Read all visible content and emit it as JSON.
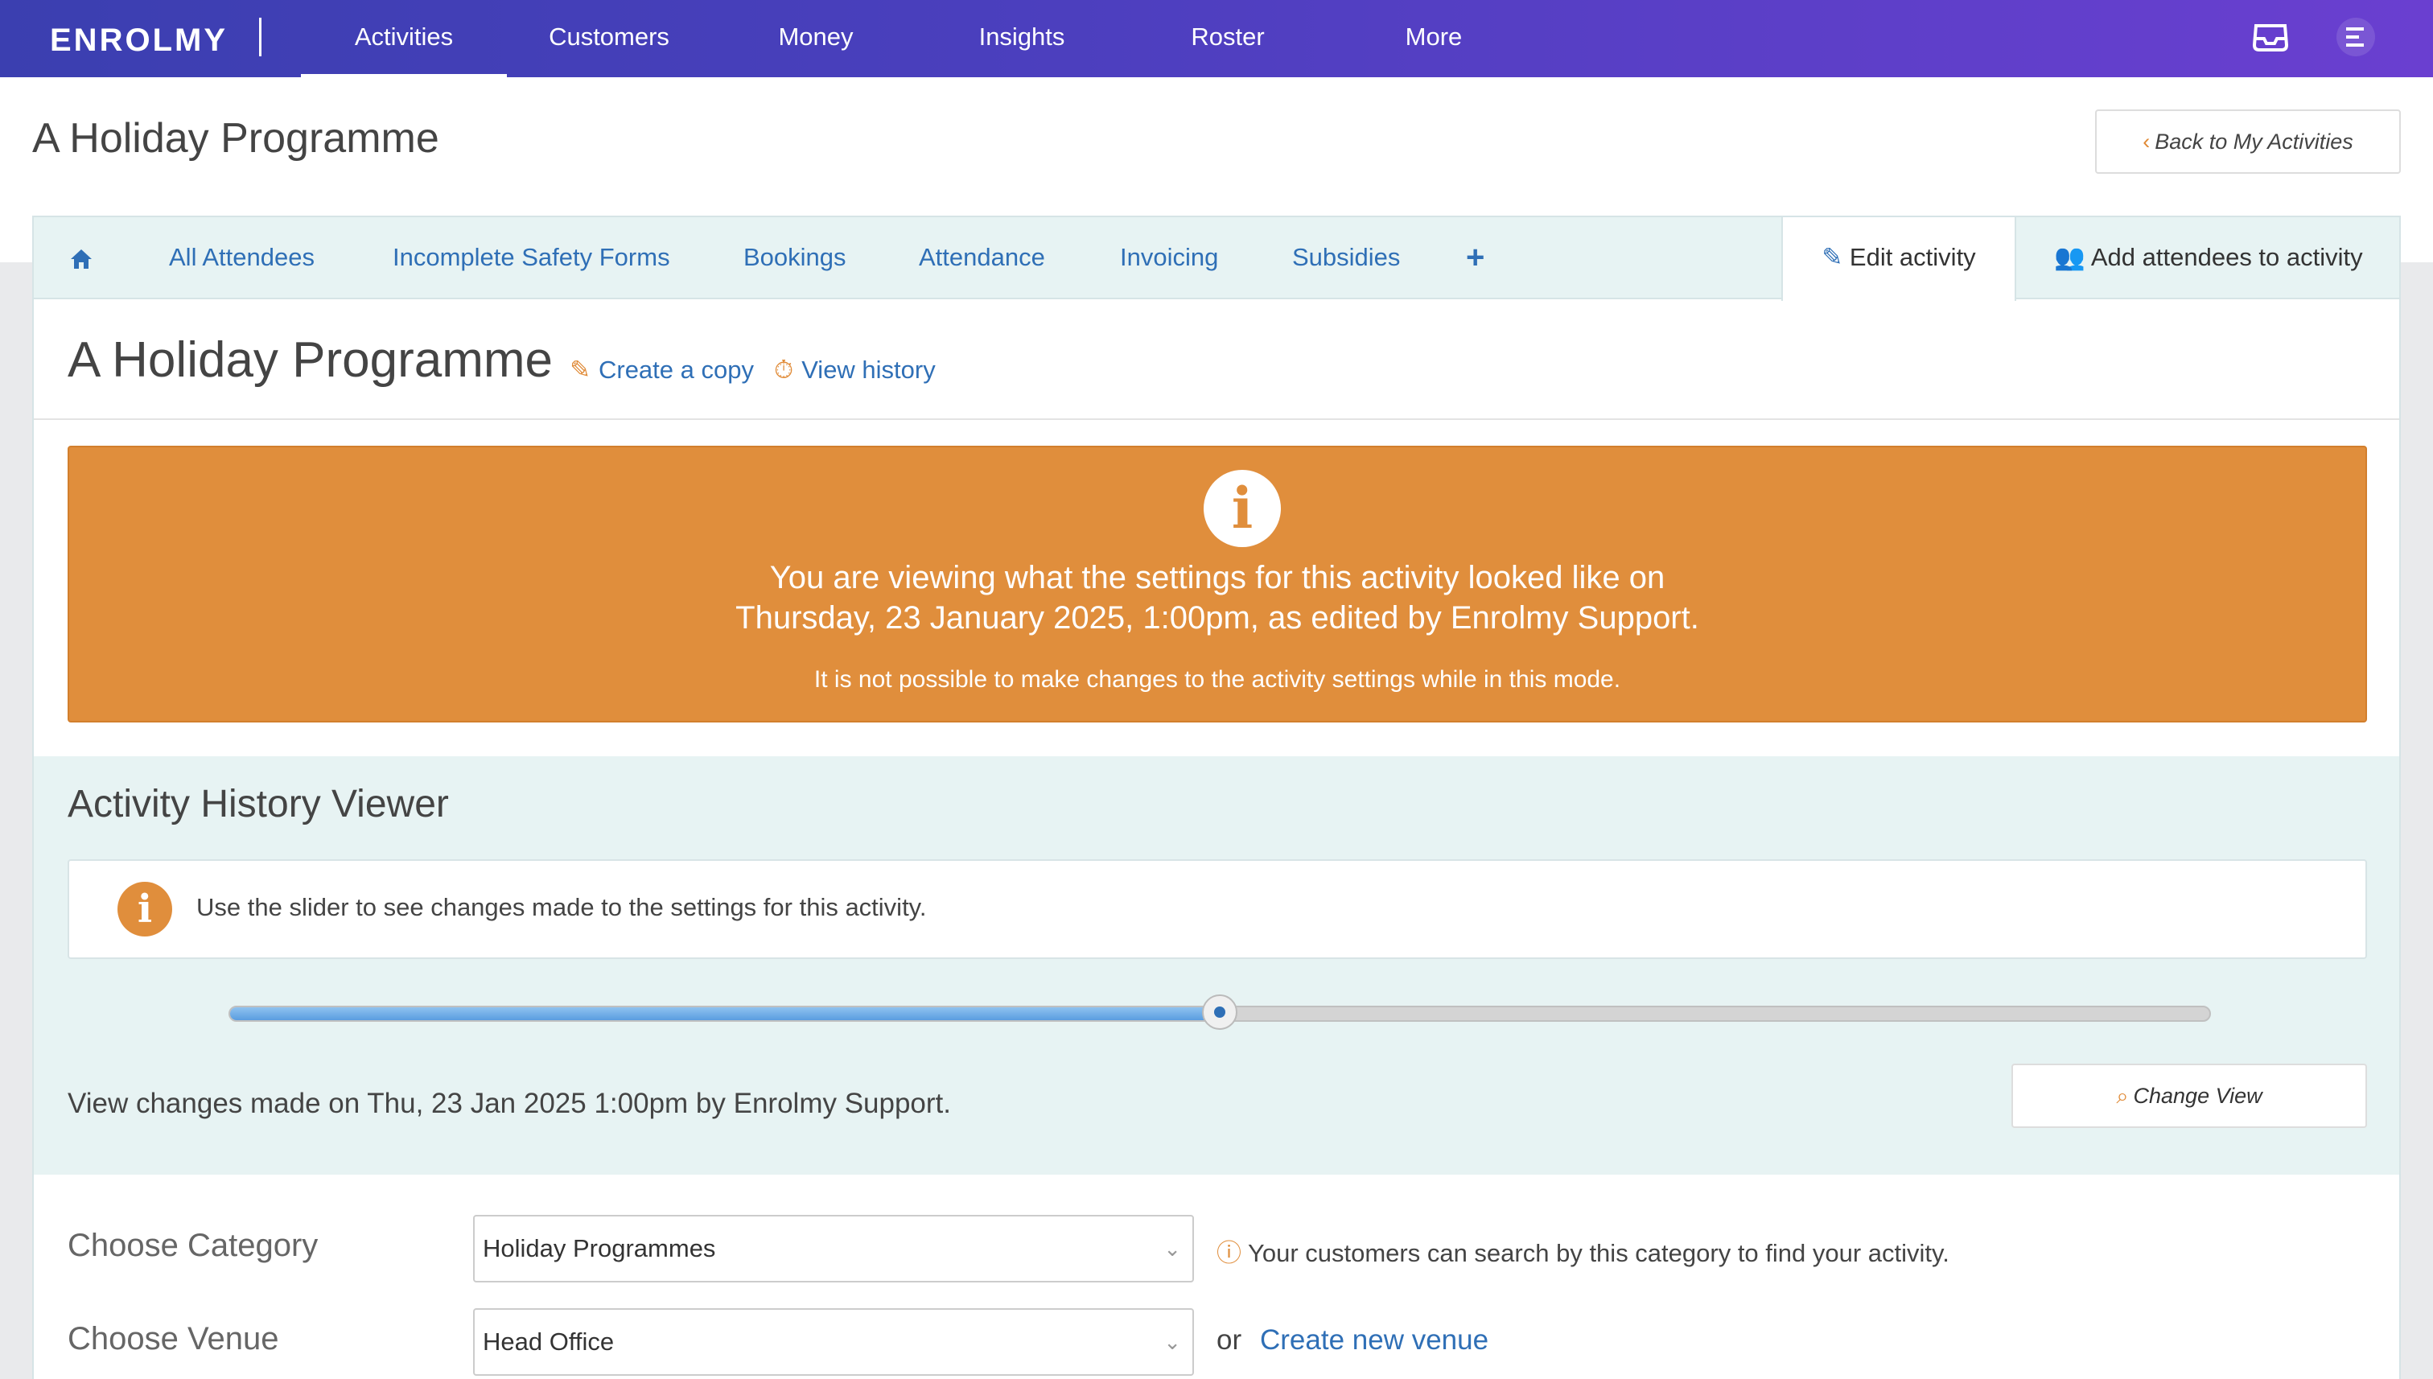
{
  "nav": {
    "logo": "ENROLMY",
    "items": [
      {
        "label": "Activities",
        "active": true
      },
      {
        "label": "Customers"
      },
      {
        "label": "Money"
      },
      {
        "label": "Insights"
      },
      {
        "label": "Roster"
      },
      {
        "label": "More"
      }
    ],
    "icons": [
      "inbox-tray-icon",
      "menu-icon"
    ]
  },
  "header": {
    "title": "A Holiday Programme",
    "back_button": "Back to My Activities"
  },
  "tabs": {
    "items": [
      "All Attendees",
      "Incomplete Safety Forms",
      "Bookings",
      "Attendance",
      "Invoicing",
      "Subsidies"
    ],
    "edit": "Edit activity",
    "add_attendees": "Add attendees to activity"
  },
  "activity": {
    "title": "A Holiday Programme",
    "create_copy": "Create a copy",
    "view_history": "View history"
  },
  "banner": {
    "line1": "You are viewing what the settings for this activity looked like on",
    "line2": "Thursday, 23 January 2025, 1:00pm, as edited by Enrolmy Support.",
    "line3": "It is not possible to make changes to the activity settings while in this mode.",
    "color": "#e08e3c"
  },
  "viewer": {
    "title": "Activity History Viewer",
    "info": "Use the slider to see changes made to the settings for this activity.",
    "slider_position": 0.5,
    "changes_text": "View changes made on Thu, 23 Jan 2025 1:00pm by Enrolmy Support.",
    "change_view_button": "Change View"
  },
  "form": {
    "category_label": "Choose Category",
    "category_value": "Holiday Programmes",
    "category_hint": "Your customers can search by this category to find your activity.",
    "venue_label": "Choose Venue",
    "venue_value": "Head Office",
    "or_text": "or",
    "create_venue": "Create new venue"
  }
}
